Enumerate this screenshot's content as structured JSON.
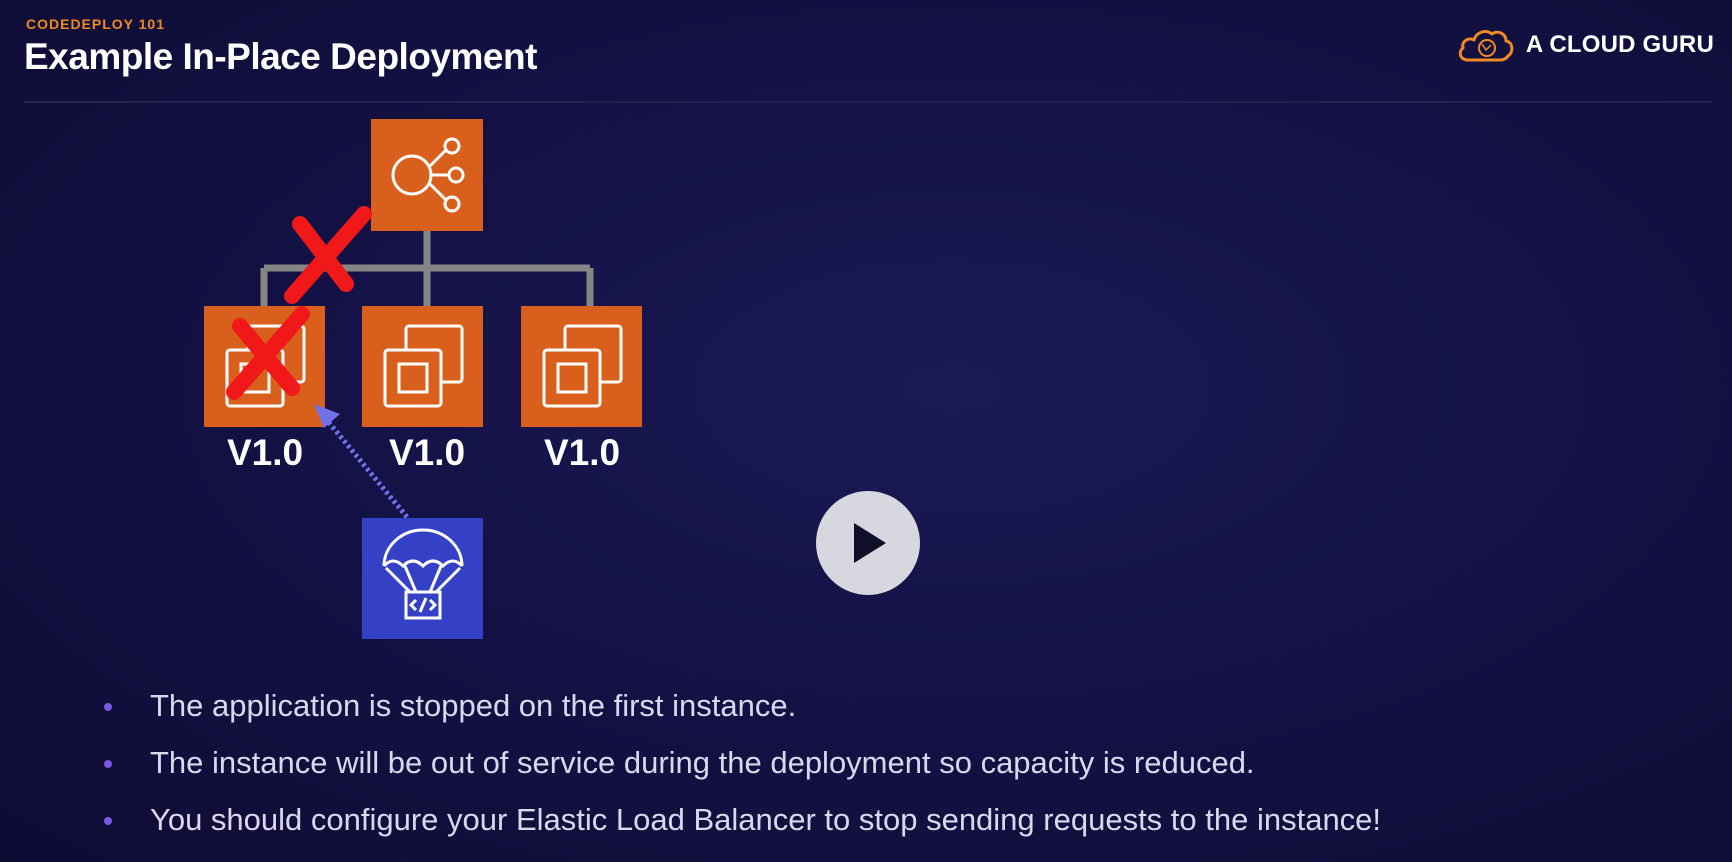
{
  "header": {
    "subtitle": "CODEDEPLOY 101",
    "title": "Example In-Place Deployment"
  },
  "brand": {
    "name": "A CLOUD GURU",
    "logo_icon": "cloud-logo-icon"
  },
  "diagram": {
    "load_balancer_icon": "elastic-load-balancer-icon",
    "instances": [
      {
        "version": "V1.0",
        "icon": "ec2-instance-icon",
        "status": "stopped"
      },
      {
        "version": "V1.0",
        "icon": "ec2-instance-icon",
        "status": "running"
      },
      {
        "version": "V1.0",
        "icon": "ec2-instance-icon",
        "status": "running"
      }
    ],
    "codedeploy_icon": "codedeploy-parachute-icon"
  },
  "player": {
    "play_icon": "play-icon"
  },
  "bullets": [
    "The application is stopped on the first instance.",
    "The instance will be out of service during the deployment so capacity is reduced.",
    "You should configure your Elastic Load Balancer to stop sending requests to the instance!"
  ],
  "colors": {
    "background": "#141246",
    "accent": "#f08a24",
    "aws_orange": "#d9601c",
    "codedeploy_blue": "#3441c6",
    "cross_red": "#f01818",
    "arrow_blue": "#6f72e8",
    "bullet_dot": "#7d57e6"
  }
}
